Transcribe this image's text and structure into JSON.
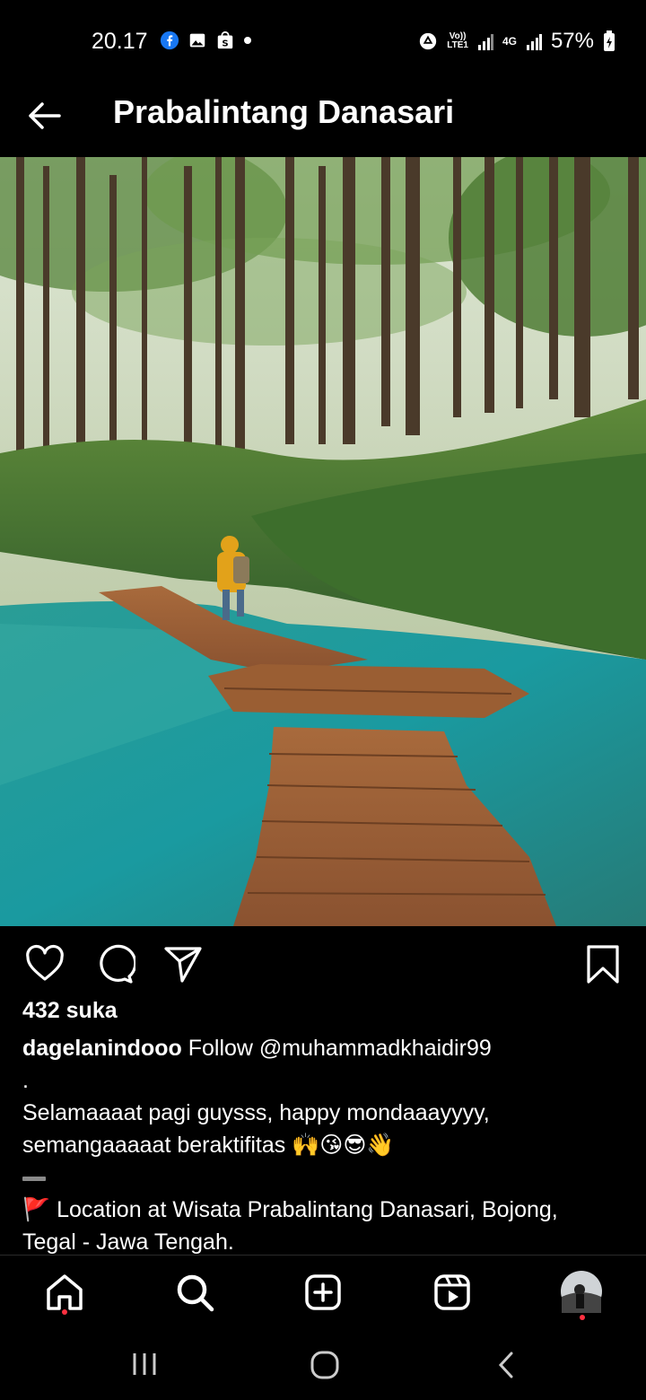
{
  "status_bar": {
    "time": "20.17",
    "battery": "57%",
    "network_4g": "4G",
    "volte_top": "Vo))",
    "volte_bottom": "LTE1"
  },
  "header": {
    "title": "Prabalintang Danasari"
  },
  "post": {
    "likes_text": "432 suka",
    "username": "dagelanindooo",
    "caption_line1": "Follow @muhammadkhaidir99",
    "caption_dot": ".",
    "caption_line2": "Selamaaaat pagi guysss, happy mondaaayyyy,",
    "caption_line3": "semangaaaaat beraktifitas 🙌😘😎👋",
    "caption_location": "🚩 Location at Wisata Prabalintang Danasari, Bojong,",
    "caption_location2": "Tegal - Jawa Tengah."
  },
  "icons": {
    "back": "arrow-left-icon",
    "like": "heart-icon",
    "comment": "comment-icon",
    "share": "send-icon",
    "save": "bookmark-icon",
    "home": "home-icon",
    "search": "search-icon",
    "create": "plus-square-icon",
    "reels": "reels-icon",
    "profile": "avatar"
  },
  "colors": {
    "background": "#000000",
    "text": "#ffffff",
    "notification_dot": "#ff3040",
    "facebook_blue": "#1877f2"
  }
}
